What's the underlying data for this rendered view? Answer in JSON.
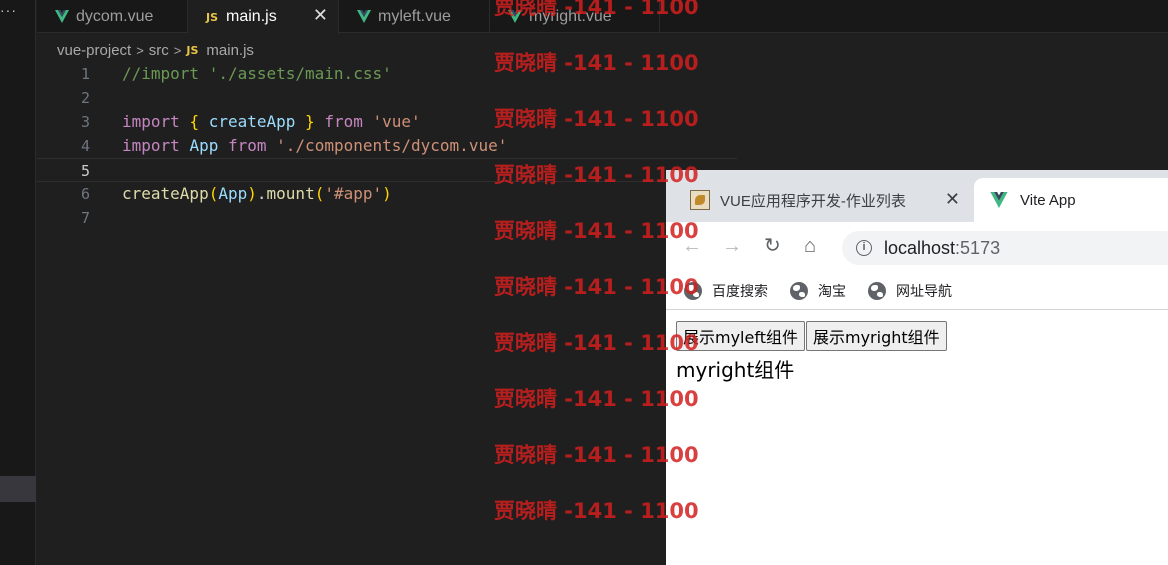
{
  "editor": {
    "activity": {
      "overflow_label": "···"
    },
    "tabs": [
      {
        "label": "dycom.vue",
        "icon": "vue-icon",
        "active": false
      },
      {
        "label": "main.js",
        "icon": "js-icon",
        "active": true,
        "close": "✕"
      },
      {
        "label": "myleft.vue",
        "icon": "vue-icon",
        "active": false
      },
      {
        "label": "myright.vue",
        "icon": "vue-icon",
        "active": false
      }
    ],
    "js_badge": "JS",
    "breadcrumb": {
      "project": "vue-project",
      "folder": "src",
      "file": "main.js",
      "separator": ">"
    },
    "lines": [
      {
        "n": "1",
        "tokens": [
          {
            "t": "//import './assets/main.css'",
            "c": "c-com"
          }
        ]
      },
      {
        "n": "2",
        "tokens": []
      },
      {
        "n": "3",
        "tokens": [
          {
            "t": "import",
            "c": "c-kw"
          },
          {
            "t": " ",
            "c": "c-pl"
          },
          {
            "t": "{",
            "c": "c-br"
          },
          {
            "t": " createApp ",
            "c": "c-var"
          },
          {
            "t": "}",
            "c": "c-br"
          },
          {
            "t": " ",
            "c": "c-pl"
          },
          {
            "t": "from",
            "c": "c-kw"
          },
          {
            "t": " ",
            "c": "c-pl"
          },
          {
            "t": "'vue'",
            "c": "c-str"
          }
        ]
      },
      {
        "n": "4",
        "tokens": [
          {
            "t": "import",
            "c": "c-kw"
          },
          {
            "t": " ",
            "c": "c-pl"
          },
          {
            "t": "App",
            "c": "c-var"
          },
          {
            "t": " ",
            "c": "c-pl"
          },
          {
            "t": "from",
            "c": "c-kw"
          },
          {
            "t": " ",
            "c": "c-pl"
          },
          {
            "t": "'./components/dycom.vue'",
            "c": "c-str"
          }
        ]
      },
      {
        "n": "5",
        "tokens": [],
        "current": true
      },
      {
        "n": "6",
        "tokens": [
          {
            "t": "createApp",
            "c": "c-fn"
          },
          {
            "t": "(",
            "c": "c-br"
          },
          {
            "t": "App",
            "c": "c-var"
          },
          {
            "t": ")",
            "c": "c-br"
          },
          {
            "t": ".",
            "c": "c-pl"
          },
          {
            "t": "mount",
            "c": "c-fn"
          },
          {
            "t": "(",
            "c": "c-br"
          },
          {
            "t": "'#app'",
            "c": "c-str"
          },
          {
            "t": ")",
            "c": "c-br"
          }
        ]
      },
      {
        "n": "7",
        "tokens": []
      }
    ]
  },
  "watermark": {
    "text": "贾晓晴 -141 - 1100",
    "color": "#d21e1e"
  },
  "browser": {
    "tabs": [
      {
        "title": "VUE应用程序开发-作业列表",
        "close": "✕"
      },
      {
        "title": "Vite App"
      }
    ],
    "nav": {
      "back": "←",
      "forward": "→",
      "reload": "↻",
      "home": "⌂"
    },
    "address": {
      "info": "i",
      "host": "localhost",
      "port": ":5173"
    },
    "bookmarks": [
      "百度搜索",
      "淘宝",
      "网址导航"
    ],
    "page": {
      "buttons": [
        "展示myleft组件",
        "展示myright组件"
      ],
      "text": "myright组件"
    }
  },
  "colors": {
    "editor_bg": "#1f1f1f",
    "tab_bar_bg": "#181818",
    "vue_green": "#41b883",
    "js_yellow": "#e8c547"
  }
}
